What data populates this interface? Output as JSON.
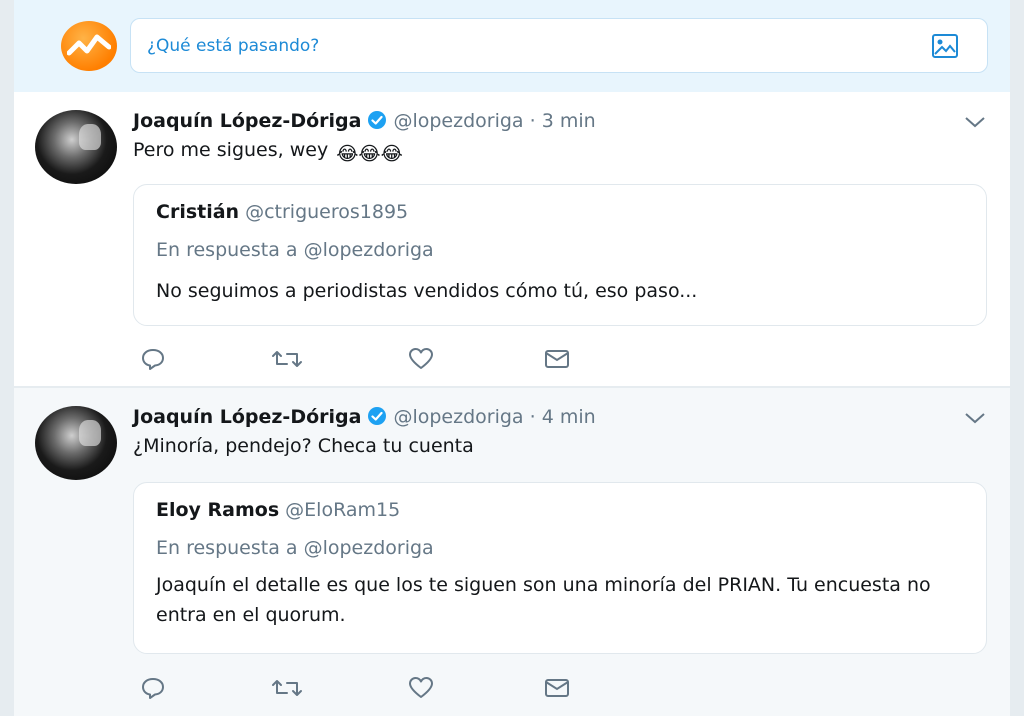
{
  "composer": {
    "placeholder": "¿Qué está pasando?",
    "avatar_icon": "brand-logo-icon",
    "media_icon": "image-icon"
  },
  "colors": {
    "accent": "#1d8ad6",
    "verified": "#1da1f2",
    "muted": "#657786",
    "text": "#14171a"
  },
  "tweets": [
    {
      "name": "Joaquín López-Dóriga",
      "handle": "@lopezdoriga",
      "sep": "·",
      "time": "3 min",
      "text": "Pero me sigues, wey",
      "emojis": "😂😂😂",
      "quote": {
        "name": "Cristián",
        "handle": "@ctrigueros1895",
        "reply_to": "En respuesta a @lopezdoriga",
        "text": "No seguimos a periodistas vendidos cómo tú, eso paso..."
      }
    },
    {
      "name": "Joaquín López-Dóriga",
      "handle": "@lopezdoriga",
      "sep": "·",
      "time": "4 min",
      "text": "¿Minoría, pendejo? Checa tu cuenta",
      "quote": {
        "name": "Eloy Ramos",
        "handle": "@EloRam15",
        "reply_to": "En respuesta a @lopezdoriga",
        "text": "Joaquín el detalle es que los te siguen son una minoría del PRIAN. Tu encuesta no entra en el quorum."
      }
    }
  ],
  "action_icons": [
    "reply-icon",
    "retweet-icon",
    "like-icon",
    "direct-message-icon"
  ]
}
